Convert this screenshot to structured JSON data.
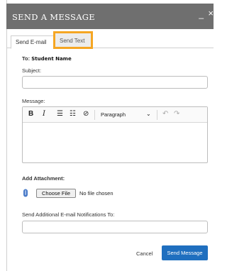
{
  "dialog": {
    "title": "SEND A MESSAGE",
    "minimize": "_",
    "close": "×"
  },
  "tabs": [
    {
      "label": "Send E-mail",
      "active": true
    },
    {
      "label": "Send Text",
      "active": false,
      "highlighted": true
    }
  ],
  "to": {
    "label": "To:",
    "value": "Student Name"
  },
  "subject": {
    "label": "Subject:",
    "value": ""
  },
  "message": {
    "label": "Message:",
    "toolbar": {
      "bold": "B",
      "italic": "I",
      "bullets": "☰",
      "numbers": "☷",
      "link": "⊘",
      "block_format": "Paragraph",
      "undo": "↶",
      "redo": "↷"
    },
    "value": ""
  },
  "attachment": {
    "label": "Add Attachment:",
    "button": "Choose File",
    "status": "No file chosen",
    "icon": "paperclip-icon"
  },
  "notifications": {
    "label": "Send Additional E-mail Notifications To:",
    "value": ""
  },
  "actions": {
    "cancel": "Cancel",
    "send": "Send Message"
  },
  "colors": {
    "titlebar": "#6f6f6f",
    "highlight": "#f5a623",
    "primary": "#1f6fbf"
  }
}
